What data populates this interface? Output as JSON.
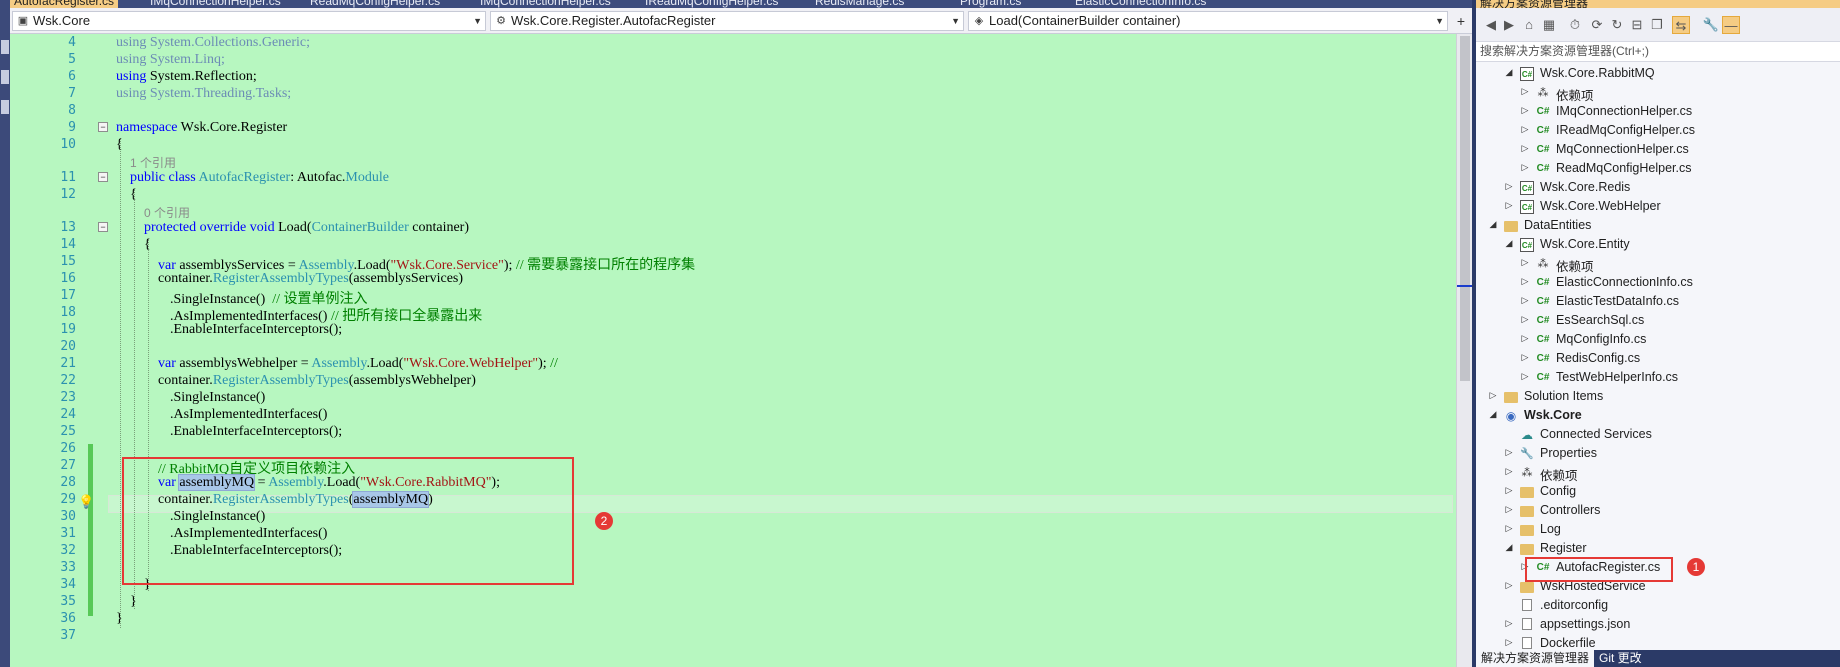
{
  "tabs": [
    {
      "label": "AutofacRegister.cs",
      "active": true
    },
    {
      "label": "IMqConnectionHelper.cs",
      "active": false
    },
    {
      "label": "ReadMqConfigHelper.cs",
      "active": false
    },
    {
      "label": "IMqConnectionHelper.cs",
      "active": false
    },
    {
      "label": "IReadMqConfigHelper.cs",
      "active": false
    },
    {
      "label": "RedisManage.cs",
      "active": false
    },
    {
      "label": "Program.cs",
      "active": false
    },
    {
      "label": "ElasticConnectionInfo.cs",
      "active": false
    }
  ],
  "navbar": {
    "project": "Wsk.Core",
    "class": "Wsk.Core.Register.AutofacRegister",
    "member": "Load(ContainerBuilder container)",
    "split": "+"
  },
  "editor": {
    "line_numbers": [
      "4",
      "5",
      "6",
      "7",
      "8",
      "9",
      "10",
      "11",
      "12",
      "13",
      "14",
      "15",
      "16",
      "17",
      "18",
      "19",
      "20",
      "21",
      "22",
      "23",
      "24",
      "25",
      "26",
      "27",
      "28",
      "29",
      "30",
      "31",
      "32",
      "33",
      "34",
      "35",
      "36",
      "37"
    ],
    "lines": {
      "l4": "using System.Collections.Generic;",
      "l5": "using System.Linq;",
      "l6_kw": "using",
      "l6_rest": " System.Reflection;",
      "l7": "using System.Threading.Tasks;",
      "l9_kw": "namespace",
      "l9_rest": " Wsk.Core.Register",
      "l10": "{",
      "lens_class": "1 个引用",
      "l11_kw": "public class",
      "l11_name": "AutofacRegister",
      "l11_mid": ": Autofac.",
      "l11_base": "Module",
      "l12": "{",
      "lens_method": "0 个引用",
      "l13_kw": "protected override void",
      "l13_name": " Load(",
      "l13_type": "ContainerBuilder",
      "l13_rest": " container)",
      "l14": "{",
      "l15_kw": "var",
      "l15_a": " assemblysServices = ",
      "l15_type": "Assembly",
      "l15_b": ".Load(",
      "l15_str": "\"Wsk.Core.Service\"",
      "l15_c": "); ",
      "l15_cmt": "// 需要暴露接口所在的程序集",
      "l16_a": "container.",
      "l16_m": "RegisterAssemblyTypes",
      "l16_b": "(assemblysServices)",
      "l17_a": ".SingleInstance()  ",
      "l17_cmt": "// 设置单例注入",
      "l18_a": ".AsImplementedInterfaces() ",
      "l18_cmt": "// 把所有接口全暴露出来",
      "l19": ".EnableInterfaceInterceptors();",
      "l21_kw": "var",
      "l21_a": " assemblysWebhelper = ",
      "l21_type": "Assembly",
      "l21_b": ".Load(",
      "l21_str": "\"Wsk.Core.WebHelper\"",
      "l21_c": "); ",
      "l21_cmt": "//",
      "l22_a": "container.",
      "l22_m": "RegisterAssemblyTypes",
      "l22_b": "(assemblysWebhelper)",
      "l23": ".SingleInstance()",
      "l24": ".AsImplementedInterfaces()",
      "l25": ".EnableInterfaceInterceptors();",
      "l27_cmt": "// RabbitMQ自定义项目依赖注入",
      "l28_kw": "var",
      "l28_var": "assemblyMQ",
      "l28_a": " = ",
      "l28_type": "Assembly",
      "l28_b": ".Load(",
      "l28_str": "\"Wsk.Core.RabbitMQ\"",
      "l28_c": ");",
      "l29_a": "container.",
      "l29_m": "RegisterAssemblyTypes",
      "l29_b": "(",
      "l29_var": "assemblyMQ",
      "l29_c": ")",
      "l30": ".SingleInstance()",
      "l31": ".AsImplementedInterfaces()",
      "l32": ".EnableInterfaceInterceptors();",
      "l34": "}",
      "l35": "}",
      "l36": "}"
    },
    "badge_2": "2"
  },
  "solution_explorer": {
    "title": "解决方案资源管理器",
    "search_placeholder": "搜索解决方案资源管理器(Ctrl+;)",
    "items": [
      {
        "label": "Wsk.Core.RabbitMQ"
      },
      {
        "label": "依赖项"
      },
      {
        "label": "IMqConnectionHelper.cs"
      },
      {
        "label": "IReadMqConfigHelper.cs"
      },
      {
        "label": "MqConnectionHelper.cs"
      },
      {
        "label": "ReadMqConfigHelper.cs"
      },
      {
        "label": "Wsk.Core.Redis"
      },
      {
        "label": "Wsk.Core.WebHelper"
      },
      {
        "label": "DataEntities"
      },
      {
        "label": "Wsk.Core.Entity"
      },
      {
        "label": "依赖项"
      },
      {
        "label": "ElasticConnectionInfo.cs"
      },
      {
        "label": "ElasticTestDataInfo.cs"
      },
      {
        "label": "EsSearchSql.cs"
      },
      {
        "label": "MqConfigInfo.cs"
      },
      {
        "label": "RedisConfig.cs"
      },
      {
        "label": "TestWebHelperInfo.cs"
      },
      {
        "label": "Solution Items"
      },
      {
        "label": "Wsk.Core"
      },
      {
        "label": "Connected Services"
      },
      {
        "label": "Properties"
      },
      {
        "label": "依赖项"
      },
      {
        "label": "Config"
      },
      {
        "label": "Controllers"
      },
      {
        "label": "Log"
      },
      {
        "label": "Register"
      },
      {
        "label": "AutofacRegister.cs"
      },
      {
        "label": "WskHostedService"
      },
      {
        "label": ".editorconfig"
      },
      {
        "label": "appsettings.json"
      },
      {
        "label": "Dockerfile"
      }
    ],
    "badge_1": "1",
    "bottom_tabs": [
      "解决方案资源管理器",
      "Git 更改"
    ]
  }
}
